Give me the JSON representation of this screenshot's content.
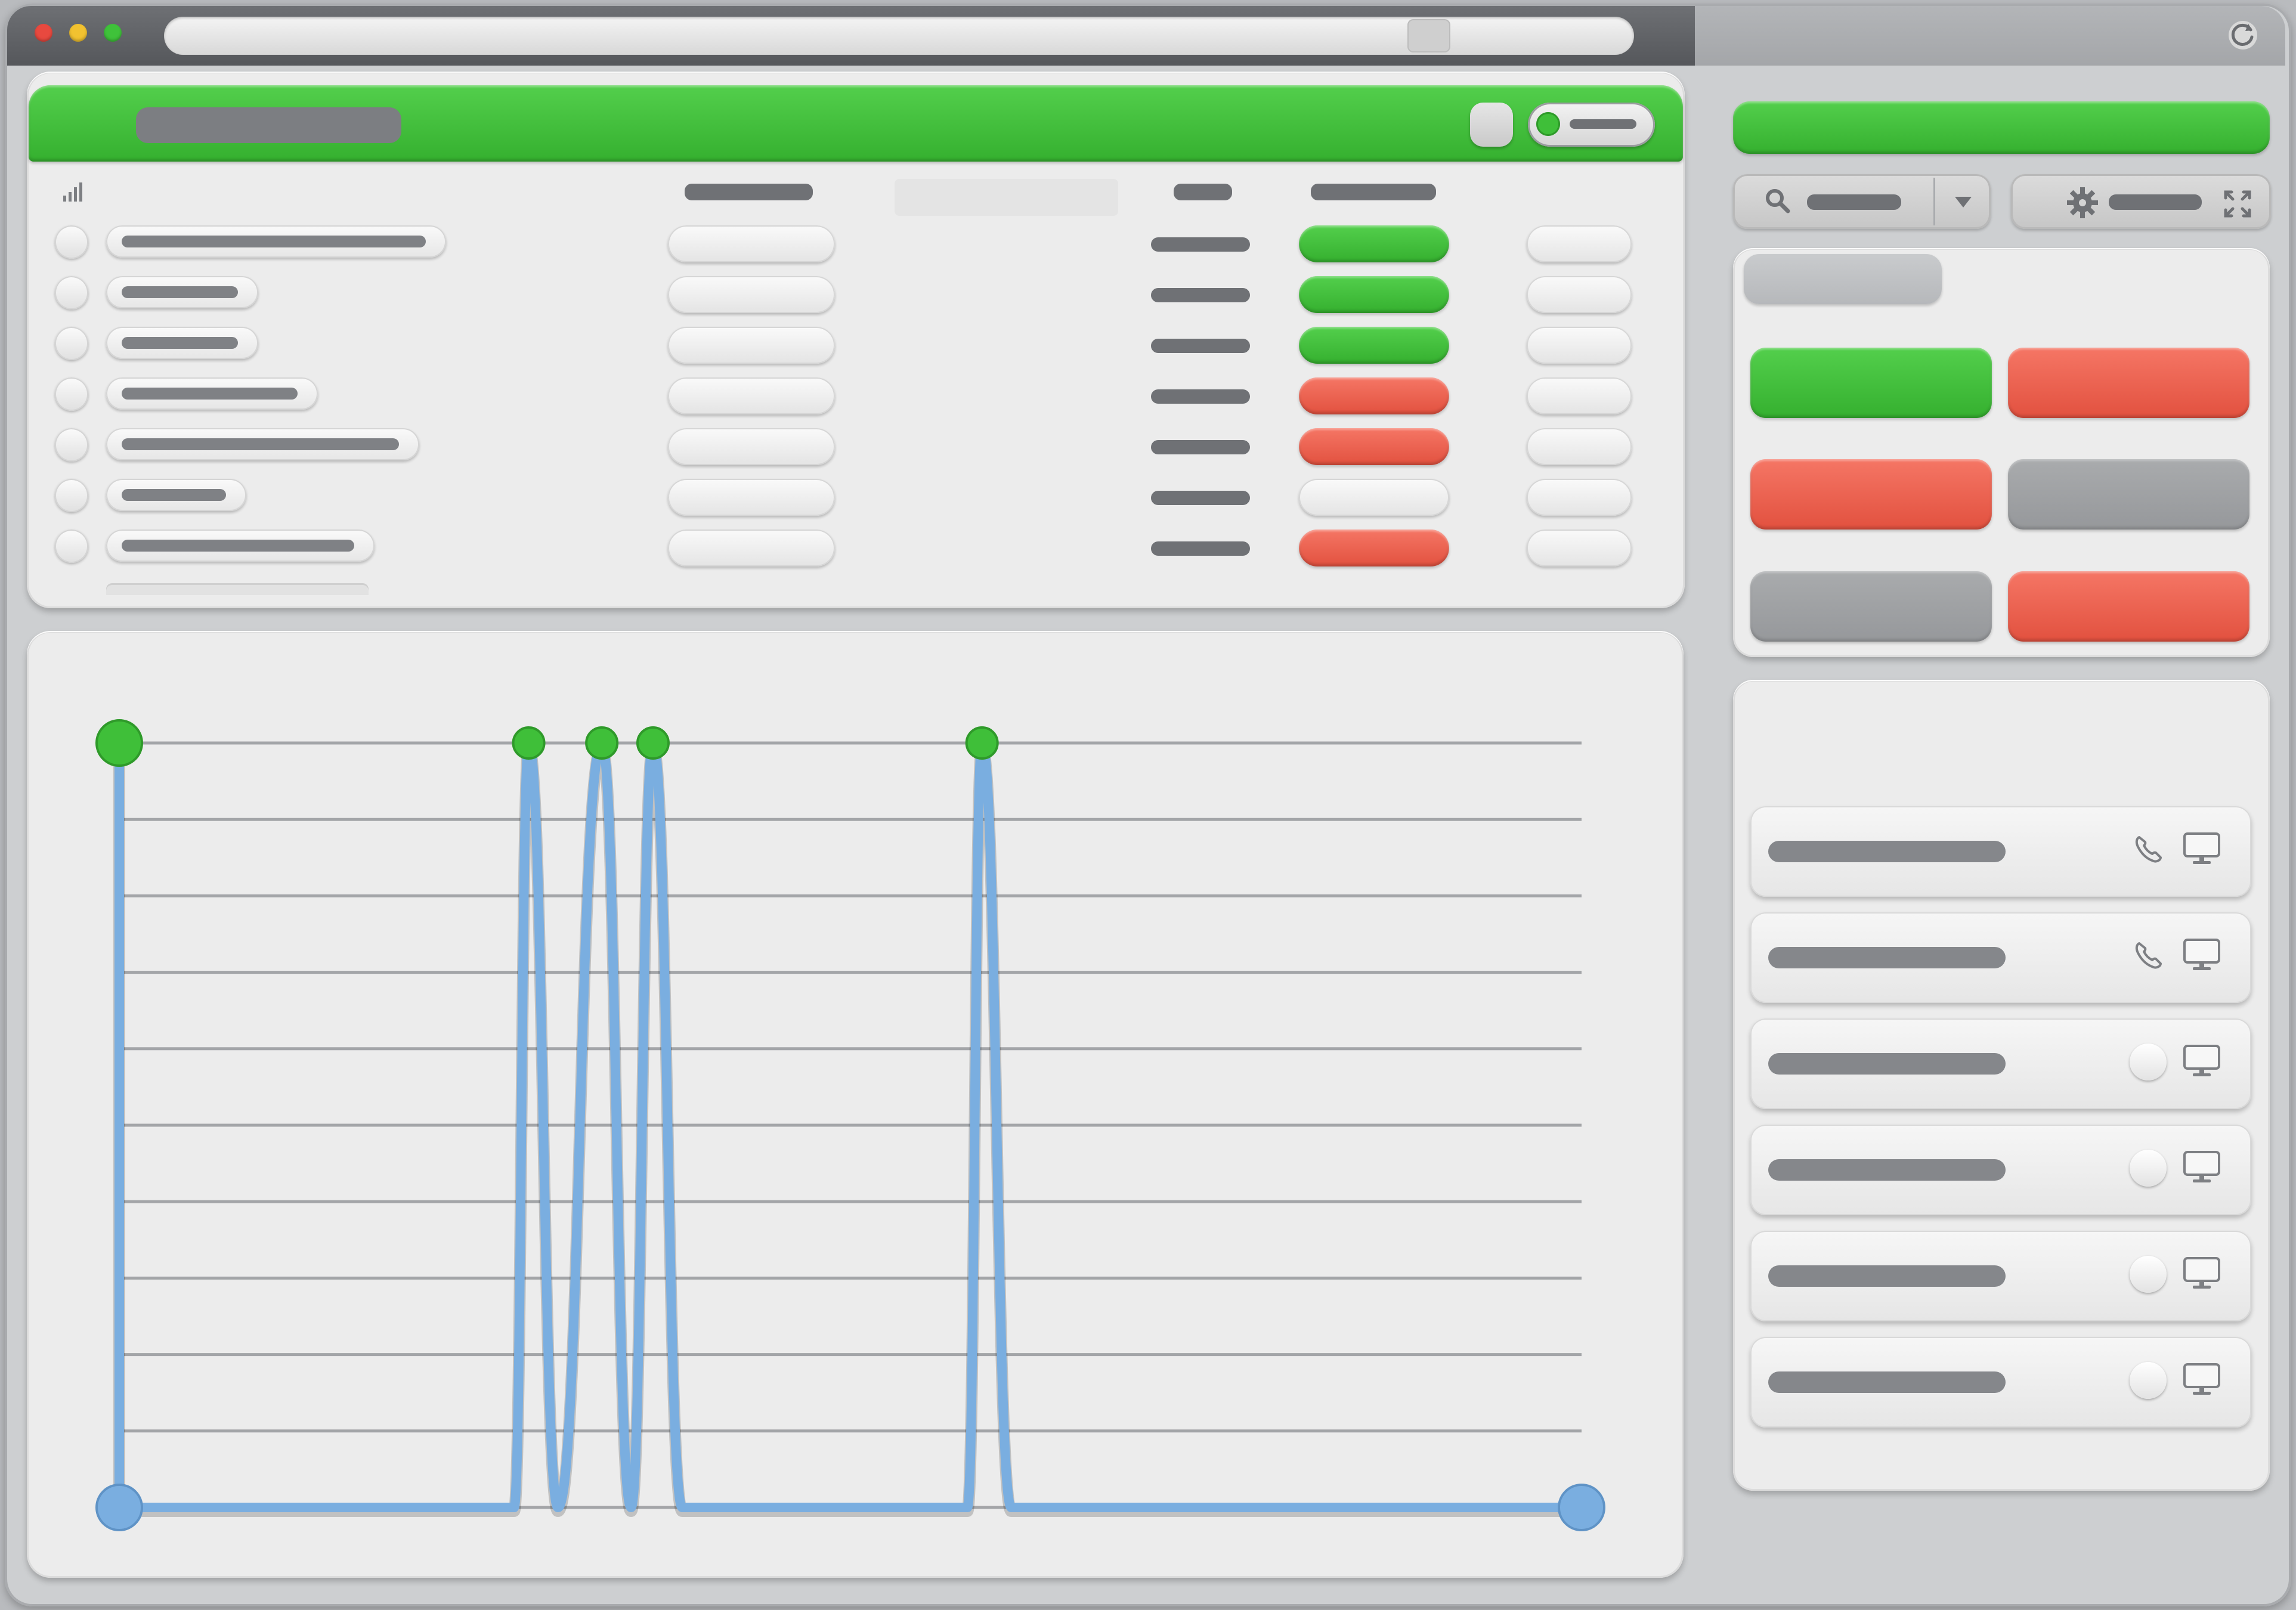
{
  "window": {
    "title": "",
    "address": "",
    "traffic_lights": [
      "#e8493f",
      "#f2c230",
      "#3fc23a"
    ],
    "refresh_icon": "refresh-icon"
  },
  "table_panel": {
    "title": "",
    "toggle_state": "on",
    "header_icon": "signal-bars-icon",
    "columns": [
      "",
      "",
      "",
      "",
      ""
    ],
    "rows": [
      {
        "name": "",
        "value": "",
        "metric": "",
        "status": "green",
        "action": ""
      },
      {
        "name": "",
        "value": "",
        "metric": "",
        "status": "green",
        "action": ""
      },
      {
        "name": "",
        "value": "",
        "metric": "",
        "status": "green",
        "action": ""
      },
      {
        "name": "",
        "value": "",
        "metric": "",
        "status": "red",
        "action": ""
      },
      {
        "name": "",
        "value": "",
        "metric": "",
        "status": "red",
        "action": ""
      },
      {
        "name": "",
        "value": "",
        "metric": "",
        "status": "white",
        "action": ""
      },
      {
        "name": "",
        "value": "",
        "metric": "",
        "status": "red",
        "action": ""
      }
    ]
  },
  "side_panel": {
    "header_label": "",
    "search_placeholder": "",
    "search_icon": "search-icon",
    "dropdown_icon": "chevron-down-icon",
    "settings_icon": "gear-icon",
    "settings_label": "",
    "expand_icon": "expand-icon",
    "status_card_title": "",
    "status_tiles": [
      {
        "label": "",
        "color": "green"
      },
      {
        "label": "",
        "color": "red"
      },
      {
        "label": "",
        "color": "red"
      },
      {
        "label": "",
        "color": "grey"
      },
      {
        "label": "",
        "color": "grey"
      },
      {
        "label": "",
        "color": "red"
      }
    ],
    "device_list_title": "",
    "devices": [
      {
        "name": "",
        "left_icon": "phone-icon",
        "right_icon": "monitor-icon"
      },
      {
        "name": "",
        "left_icon": "phone-icon",
        "right_icon": "monitor-icon"
      },
      {
        "name": "",
        "left_icon": "circle-icon",
        "right_icon": "monitor-icon"
      },
      {
        "name": "",
        "left_icon": "circle-icon",
        "right_icon": "monitor-icon"
      },
      {
        "name": "",
        "left_icon": "circle-icon",
        "right_icon": "monitor-icon"
      },
      {
        "name": "",
        "left_icon": "circle-icon",
        "right_icon": "monitor-icon"
      }
    ]
  },
  "colors": {
    "accent_green": "#3fbf39",
    "alert_red": "#ec5f4c",
    "neutral_grey": "#9d9fa2",
    "line_blue": "#7aaee0"
  },
  "chart_data": {
    "type": "line",
    "title": "",
    "xlabel": "",
    "ylabel": "",
    "grid": true,
    "xlim": [
      0,
      100
    ],
    "ylim": [
      0,
      1
    ],
    "series": [
      {
        "color": "#7aaee0",
        "points": [
          [
            0,
            1
          ],
          [
            0,
            0
          ],
          [
            27,
            0
          ],
          [
            28,
            1
          ],
          [
            30,
            0
          ],
          [
            33,
            1
          ],
          [
            35,
            0
          ],
          [
            36.5,
            1
          ],
          [
            38.5,
            0
          ],
          [
            58,
            0
          ],
          [
            59,
            1
          ],
          [
            61,
            0
          ],
          [
            100,
            0
          ]
        ],
        "peak_markers": [
          0,
          28,
          33,
          36.5,
          59
        ],
        "end_markers": [
          0,
          100
        ]
      }
    ]
  }
}
